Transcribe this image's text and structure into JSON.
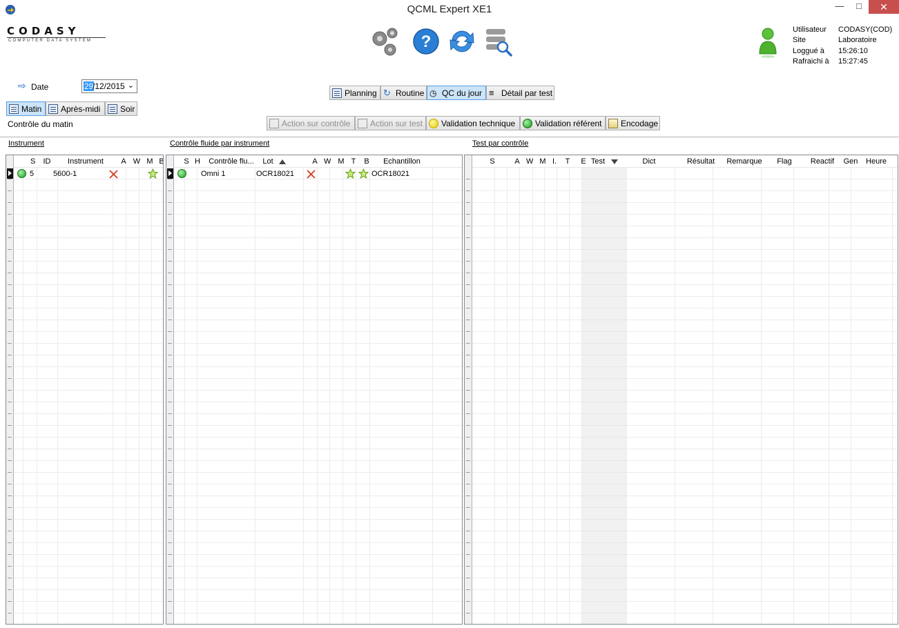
{
  "window": {
    "title": "QCML Expert XE1"
  },
  "logo": {
    "word": "CODASY",
    "sub": "COMPUTER DATA SYSTEM"
  },
  "user_info": {
    "user_label": "Utilisateur",
    "user_value": "CODASY(COD)",
    "site_label": "Site",
    "site_value": "Laboratoire",
    "login_label": "Loggué à",
    "login_value": "15:26:10",
    "refresh_label": "Rafraichi à",
    "refresh_value": "15:27:45"
  },
  "date": {
    "label": "Date",
    "day": "29",
    "rest": "/12/2015"
  },
  "periods": {
    "morning": "Matin",
    "afternoon": "Après-midi",
    "evening": "Soir"
  },
  "mode_label": "Contrôle du matin",
  "views": {
    "planning": "Planning",
    "routine": "Routine",
    "qc_today": "QC du jour",
    "detail": "Détail par test"
  },
  "actions": {
    "action_control": "Action sur contrôle",
    "action_test": "Action sur test",
    "tech_validation": "Validation technique",
    "ref_validation": "Validation référent",
    "encoding": "Encodage"
  },
  "instrument_panel": {
    "title": "Instrument",
    "columns": [
      "S",
      "ID",
      "Instrument",
      "A",
      "W",
      "M",
      "B"
    ],
    "rows": [
      {
        "id": "5",
        "instrument": "5600-1"
      }
    ]
  },
  "control_panel": {
    "title": "Contrôle fluide par instrument",
    "columns": [
      "S",
      "H",
      "Contrôle flu...",
      "Lot",
      "A",
      "W",
      "M",
      "T",
      "B",
      "Echantillon"
    ],
    "rows": [
      {
        "control": "Omni 1",
        "lot": "OCR18021",
        "sample": "OCR18021"
      }
    ]
  },
  "test_panel": {
    "title": "Test par contrôle",
    "columns": [
      "S",
      "A",
      "W",
      "M",
      "I.",
      "T",
      "E",
      "Test",
      "Dict",
      "Résultat",
      "Remarque",
      "Flag",
      "Reactif",
      "Gen",
      "Heure"
    ]
  },
  "colors": {
    "accent": "#3399ff",
    "status_ok": "#1f9b1f",
    "close_button": "#c7504f",
    "star": "#8cc63f",
    "error_x": "#d23c1e"
  }
}
